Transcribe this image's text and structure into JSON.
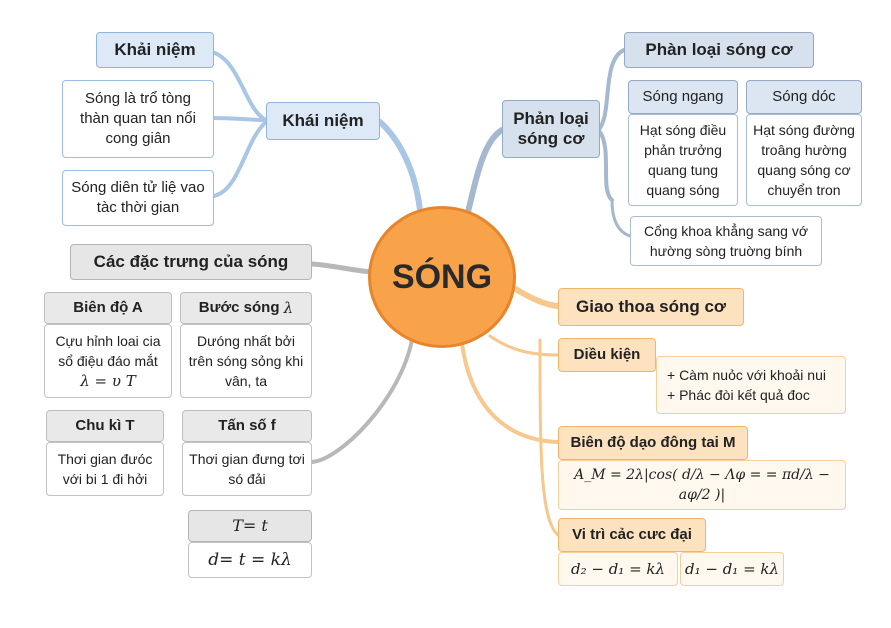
{
  "center": {
    "title": "SÓNG"
  },
  "colors": {
    "blue": "#8fb4dd",
    "slate": "#93a9c4",
    "gray": "#b5b5b5",
    "orange": "#f3b46a",
    "center": "#f8a24a"
  },
  "khai_niem": {
    "branch": "Khái niệm",
    "top": "Khải niệm",
    "def1": "Sóng là trổ tòng thàn quan tan nổi cong giân",
    "def2": "Sóng diên tử liệ vao tàc thời gian"
  },
  "phan_loai": {
    "branch": "Phản loại sóng cơ",
    "top": "Phàn loại sóng cơ",
    "ngang": {
      "title": "Sóng ngang",
      "desc": "Hạt sóng điều phản trưởng quang tung quang sóng"
    },
    "doc": {
      "title": "Sóng dóc",
      "desc": "Hạt sóng đường troâng hường quang sóng cơ chuyển tron"
    },
    "note": "Cổng khoa khẳng sang vớ hường sòng truờng bính"
  },
  "dac_trung": {
    "title": "Các đặc trưng của sóng",
    "bien_do": {
      "title": "Biên độ A",
      "desc": "Cựu hỉnh loai cia sổ điệu đáo mắt",
      "formula": "λ = υ T"
    },
    "buoc_song": {
      "title": "Bước sóng",
      "symbol": "λ",
      "desc": "Dưóng nhất bởi trên sóng sỏng khi vân, ta"
    },
    "chu_ki": {
      "title": "Chu kì T",
      "desc": "Thơi gian đưóc với bi 1 đi hởi"
    },
    "tan_so": {
      "title": "Tấn số f",
      "desc": "Thơi gian đưng tơi só đải"
    },
    "formula1": "T= t",
    "formula2": "d= t = kλ"
  },
  "giao_thoa": {
    "title": "Giao thoa sóng cơ",
    "dieu_kien": {
      "title": "Diều kiện",
      "items": [
        "+ Càm nuỏc với khoải nui",
        "+ Phác đòi kết quả đoc"
      ]
    },
    "bien_do_m": {
      "title": "Biên độ dạo đông tai M",
      "formula": "A_M = 2λ|cos( d/λ − Λφ = = πd/λ − aφ/2 )|"
    },
    "vi_tri": {
      "title": "Vi trì cảc cưc đại",
      "f1": "d₂ − d₁ = kλ",
      "f2": "d₁ − d₁ = kλ"
    }
  }
}
